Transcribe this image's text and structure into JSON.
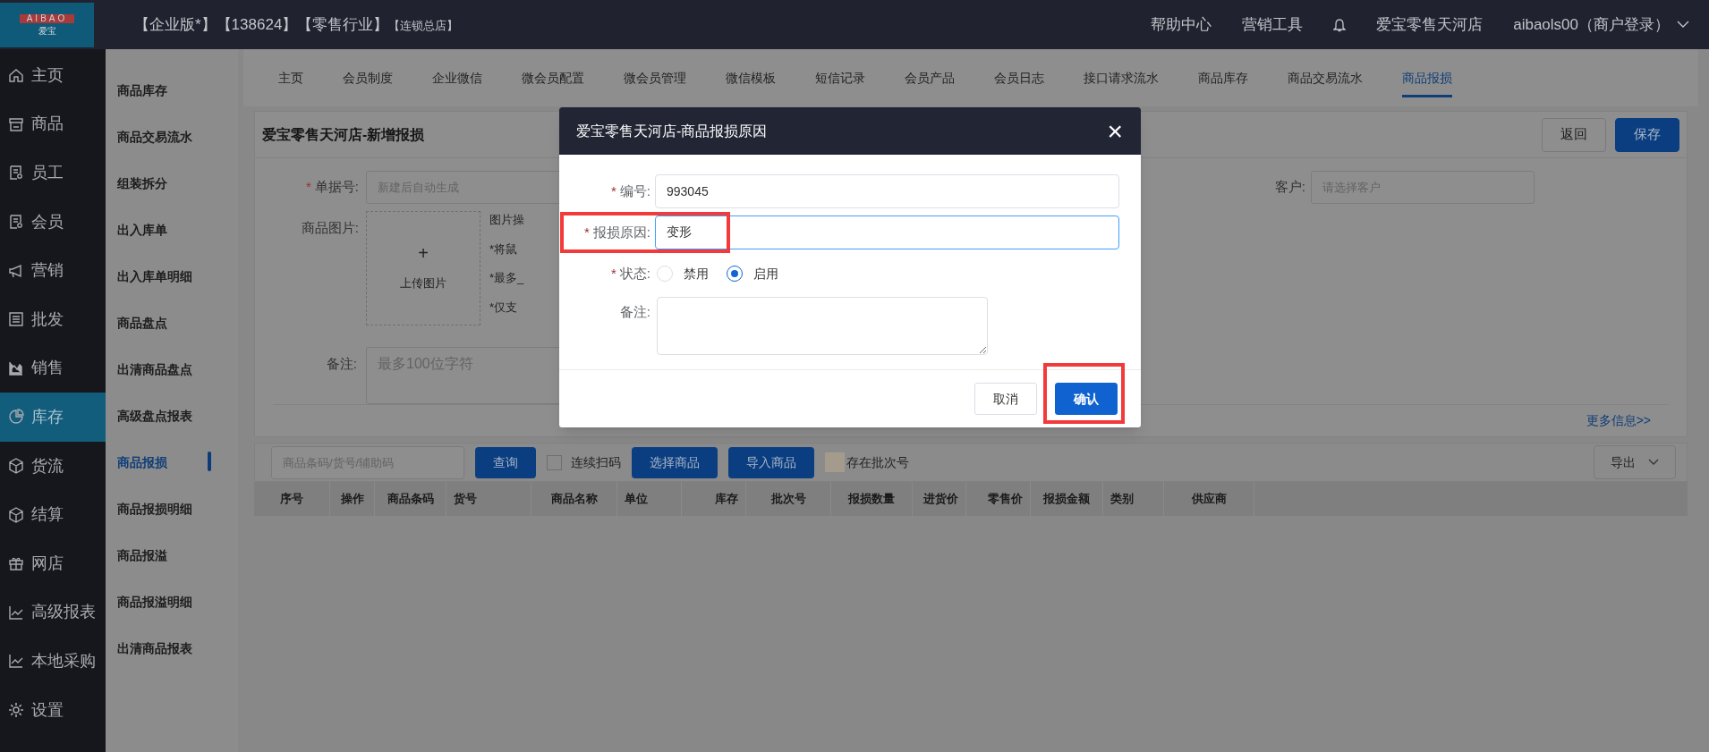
{
  "header": {
    "logo_top": "AIBAO",
    "logo_bottom": "爱宝",
    "edition": "【企业版*】【138624】【零售行业】",
    "branch": "【连锁总店】",
    "links": [
      "帮助中心",
      "营销工具"
    ],
    "store": "爱宝零售天河店",
    "user": "aibaols00（商户登录）"
  },
  "nav": [
    {
      "label": "主页",
      "kind": "home",
      "selected": false
    },
    {
      "label": "商品",
      "kind": "store",
      "selected": false
    },
    {
      "label": "员工",
      "kind": "doc",
      "selected": false
    },
    {
      "label": "会员",
      "kind": "doc",
      "selected": false
    },
    {
      "label": "营销",
      "kind": "megaphone",
      "selected": false
    },
    {
      "label": "批发",
      "kind": "list",
      "selected": false
    },
    {
      "label": "销售",
      "kind": "chart",
      "selected": false
    },
    {
      "label": "库存",
      "kind": "pie",
      "selected": true
    },
    {
      "label": "货流",
      "kind": "cube",
      "selected": false
    },
    {
      "label": "结算",
      "kind": "cube",
      "selected": false
    },
    {
      "label": "网店",
      "kind": "gift",
      "selected": false
    },
    {
      "label": "高级报表",
      "kind": "line",
      "selected": false
    },
    {
      "label": "本地采购",
      "kind": "line",
      "selected": false
    },
    {
      "label": "设置",
      "kind": "gear",
      "selected": false
    }
  ],
  "subnav": [
    {
      "label": "商品库存",
      "selected": false
    },
    {
      "label": "商品交易流水",
      "selected": false
    },
    {
      "label": "组装拆分",
      "selected": false
    },
    {
      "label": "出入库单",
      "selected": false
    },
    {
      "label": "出入库单明细",
      "selected": false
    },
    {
      "label": "商品盘点",
      "selected": false
    },
    {
      "label": "出清商品盘点",
      "selected": false
    },
    {
      "label": "高级盘点报表",
      "selected": false
    },
    {
      "label": "商品报损",
      "selected": true
    },
    {
      "label": "商品报损明细",
      "selected": false
    },
    {
      "label": "商品报溢",
      "selected": false
    },
    {
      "label": "商品报溢明细",
      "selected": false
    },
    {
      "label": "出清商品报表",
      "selected": false
    }
  ],
  "tabs": [
    {
      "label": "主页",
      "selected": false
    },
    {
      "label": "会员制度",
      "selected": false
    },
    {
      "label": "企业微信",
      "selected": false
    },
    {
      "label": "微会员配置",
      "selected": false
    },
    {
      "label": "微会员管理",
      "selected": false
    },
    {
      "label": "微信模板",
      "selected": false
    },
    {
      "label": "短信记录",
      "selected": false
    },
    {
      "label": "会员产品",
      "selected": false
    },
    {
      "label": "会员日志",
      "selected": false
    },
    {
      "label": "接口请求流水",
      "selected": false
    },
    {
      "label": "商品库存",
      "selected": false
    },
    {
      "label": "商品交易流水",
      "selected": false
    },
    {
      "label": "商品报损",
      "selected": true
    }
  ],
  "form": {
    "title": "爱宝零售天河店-新增报损",
    "buttons": [
      {
        "label": "返回",
        "kind": "default"
      },
      {
        "label": "保存",
        "kind": "primary"
      }
    ],
    "order_no": {
      "label": "单据号:",
      "required_mark": "*",
      "placeholder": "新建后自动生成"
    },
    "customer": {
      "label": "客户:",
      "placeholder": "请选择客户"
    },
    "image": {
      "label": "商品图片:",
      "plus": "+",
      "upload": "上传图片",
      "hints": [
        "图片操",
        "*将鼠",
        "*最多_",
        "*仅支"
      ]
    },
    "remark": {
      "label": "备注:",
      "placeholder": "最多100位字符"
    },
    "more": "更多信息>>"
  },
  "toolbar": {
    "search_placeholder": "商品条码/货号/辅助码",
    "query": "查询",
    "scan": {
      "label": "连续扫码",
      "checked": false
    },
    "select": "选择商品",
    "import": "导入商品",
    "batch": {
      "label": "存在批次号",
      "checked": false
    },
    "export": "导出"
  },
  "table": {
    "columns": [
      "序号",
      "操作",
      "商品条码",
      "货号",
      "商品名称",
      "单位",
      "库存",
      "批次号",
      "报损数量",
      "进货价",
      "零售价",
      "报损金额",
      "类别",
      "供应商"
    ]
  },
  "dialog": {
    "title": "爱宝零售天河店-商品报损原因",
    "close": "×",
    "fields": [
      {
        "kind": "input",
        "label": "编号:",
        "required_mark": "*",
        "value": "993045",
        "focused": false,
        "highlighted": false
      },
      {
        "kind": "input",
        "label": "报损原因:",
        "required_mark": "*",
        "value": "变形",
        "focused": true,
        "highlighted": true
      },
      {
        "kind": "radio",
        "label": "状态:",
        "required_mark": "*",
        "options": [
          {
            "label": "禁用",
            "selected": false
          },
          {
            "label": "启用",
            "selected": true
          }
        ]
      },
      {
        "kind": "textarea",
        "label": "备注:"
      }
    ],
    "buttons": [
      {
        "label": "取消",
        "kind": "default",
        "highlighted": false
      },
      {
        "label": "确认",
        "kind": "primary",
        "highlighted": true
      }
    ]
  }
}
